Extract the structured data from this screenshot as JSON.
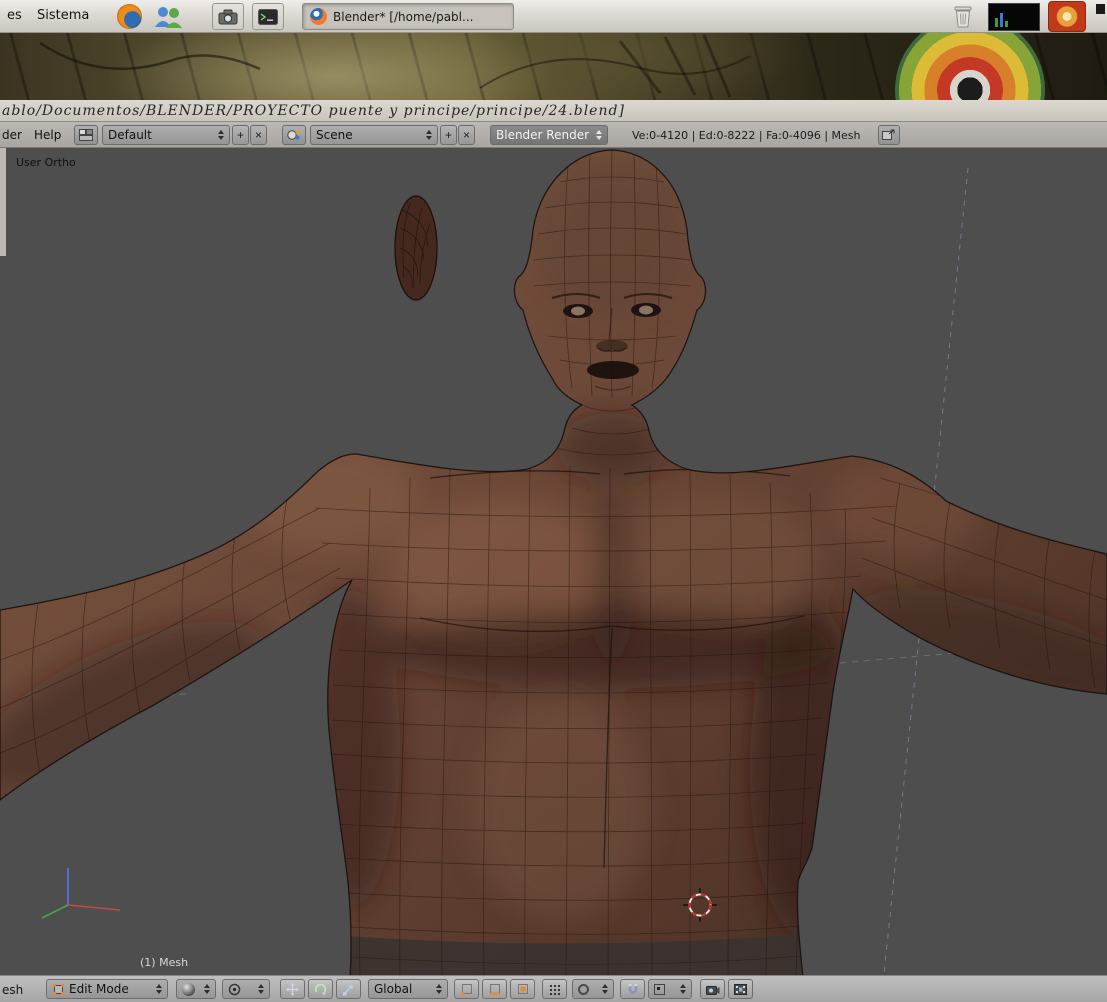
{
  "colors": {
    "viewport_bg": "#4e4e4e",
    "header_bg": "#b2aeaa",
    "panel_bg": "#d6d2cc",
    "skin_tone": "#6b4737",
    "cursor_red": "#cc2a2a"
  },
  "desktop_panel": {
    "menu_truncated": "es",
    "menu_system": "Sistema",
    "taskbar_item": "Blender* [/home/pabl..."
  },
  "window_title": "ablo/Documentos/BLENDER/PROYECTO puente y principe/principe/24.blend]",
  "info_header": {
    "menu_render_truncated": "der",
    "menu_help": "Help",
    "screen_layout": "Default",
    "add_label": "+",
    "delete_label": "×",
    "scene_name": "Scene",
    "render_engine": "Blender Render",
    "stats": "Ve:0-4120 | Ed:0-8222 | Fa:0-4096 | Mesh"
  },
  "viewport": {
    "view_label": "User Ortho",
    "object_info": "(1) Mesh"
  },
  "view3d_header": {
    "menu_mesh_truncated": "esh",
    "mode": "Edit Mode",
    "orientation": "Global"
  }
}
